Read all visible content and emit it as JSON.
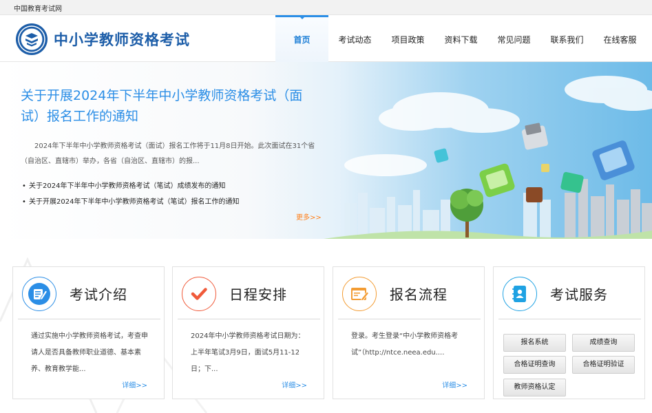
{
  "topbar": {
    "text": "中国教育考试网"
  },
  "header": {
    "title": "中小学教师资格考试"
  },
  "nav": [
    {
      "label": "首页",
      "active": true
    },
    {
      "label": "考试动态"
    },
    {
      "label": "项目政策"
    },
    {
      "label": "资料下载"
    },
    {
      "label": "常见问题"
    },
    {
      "label": "联系我们"
    },
    {
      "label": "在线客服"
    }
  ],
  "banner": {
    "headline": "关于开展2024年下半年中小学教师资格考试（面试）报名工作的通知",
    "summary": "2024年下半年中小学教师资格考试（面试）报名工作将于11月8日开始。此次面试在31个省（自治区、直辖市）举办，各省（自治区、直辖市）的报...",
    "links": [
      "关于2024年下半年中小学教师资格考试（笔试）成绩发布的通知",
      "关于开展2024年下半年中小学教师资格考试（笔试）报名工作的通知"
    ],
    "more": "更多>>"
  },
  "cards": [
    {
      "title": "考试介绍",
      "icon": "pencil-note-icon",
      "color": "#2b8ee6",
      "desc": "通过实施中小学教师资格考试，考查申请人是否具备教师职业道德、基本素养、教育教学能...",
      "detail": "详细>>"
    },
    {
      "title": "日程安排",
      "icon": "checkmark-icon",
      "color": "#f05a3a",
      "desc": "2024年中小学教师资格考试日期为：上半年笔试3月9日，面试5月11-12日；下...",
      "detail": "详细>>"
    },
    {
      "title": "报名流程",
      "icon": "browser-edit-icon",
      "color": "#f39c33",
      "desc": "登录。考生登录“中小学教师资格考试”（http://ntce.neea.edu....",
      "detail": "详细>>"
    },
    {
      "title": "考试服务",
      "icon": "contacts-book-icon",
      "color": "#1fa2e3",
      "buttons": [
        "报名系统",
        "成绩查询",
        "合格证明查询",
        "合格证明验证",
        "教师资格认定"
      ]
    }
  ]
}
